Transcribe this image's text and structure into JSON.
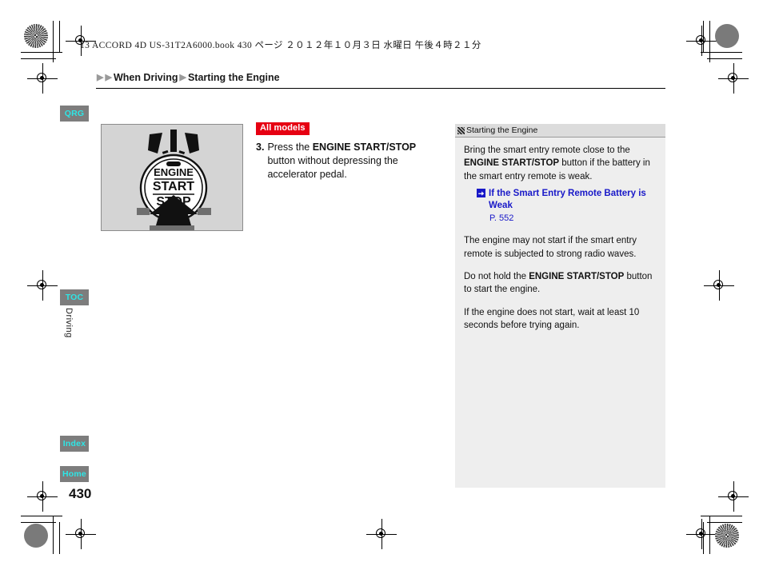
{
  "imprint": {
    "text": "13 ACCORD 4D US-31T2A6000.book  430 ページ  ２０１２年１０月３日  水曜日  午後４時２１分"
  },
  "breadcrumb": {
    "marker": "▶",
    "items": [
      "When Driving",
      "Starting the Engine"
    ]
  },
  "tabs": [
    {
      "id": "qrg",
      "label": "QRG"
    },
    {
      "id": "toc",
      "label": "TOC"
    },
    {
      "id": "index",
      "label": "Index"
    },
    {
      "id": "home",
      "label": "Home"
    }
  ],
  "chapter_label": "Driving",
  "page_number": "430",
  "figure": {
    "name": "engine-start-stop-button-illustration",
    "button_lines": [
      "ENGINE",
      "START",
      "STOP"
    ]
  },
  "main": {
    "badge": "All models",
    "step_number": "3.",
    "step_text_before": "Press the ",
    "step_text_bold": "ENGINE START/STOP",
    "step_text_after": " button without depressing the accelerator pedal."
  },
  "panel": {
    "title": "Starting the Engine",
    "paragraph1_a": "Bring the smart entry remote close to the ",
    "paragraph1_bold": "ENGINE START/STOP",
    "paragraph1_b": " button if the battery in the smart entry remote is weak.",
    "xref_label": "If the Smart Entry Remote Battery is Weak",
    "xref_page": "P. 552",
    "paragraph2": "The engine may not start if the smart entry remote is subjected to strong radio waves.",
    "paragraph3_a": "Do not hold the ",
    "paragraph3_bold": "ENGINE START/STOP",
    "paragraph3_b": " button to start the engine.",
    "paragraph4": "If the engine does not start, wait at least 10 seconds before trying again."
  },
  "colors": {
    "badge_red": "#e60012",
    "tab_bg": "#7d7d7d",
    "tab_text": "#2ee6e6",
    "link_blue": "#1818c8",
    "panel_bg": "#eeeeee",
    "figure_bg": "#d4d4d4"
  }
}
